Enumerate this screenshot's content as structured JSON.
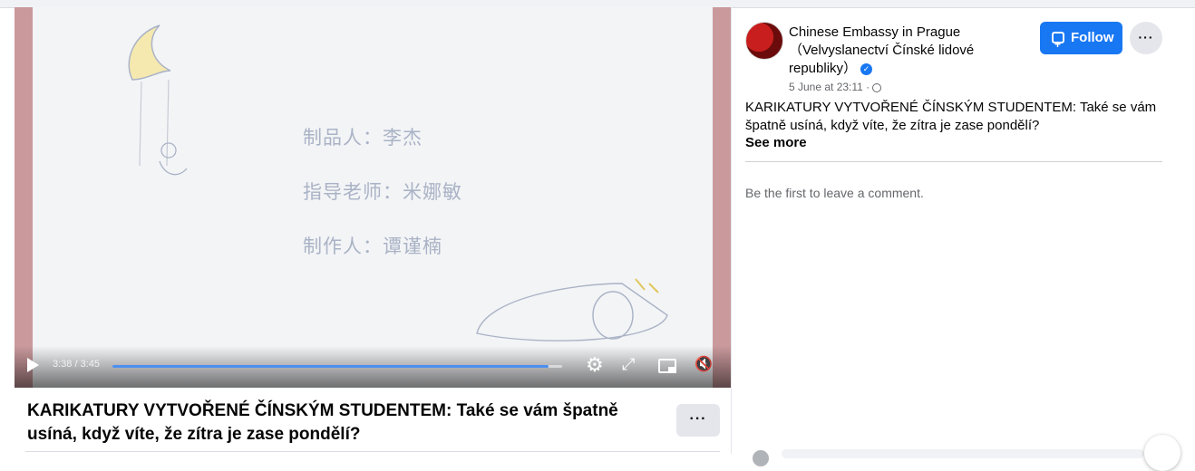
{
  "video": {
    "credits": [
      "制品人：李杰",
      "指导老师：米娜敏",
      "制作人：谭谨楠"
    ],
    "time": "3:38 / 3:45",
    "progress": 0.97
  },
  "video_title": "KARIKATURY VYTVOŘENÉ ČÍNSKÝM STUDENTEM: Také se vám špatně usíná, když víte, že zítra je zase pondělí?",
  "more_label": "···",
  "post": {
    "page_name": "Chinese Embassy in Prague （Velvyslanectví Čínské lidové republiky）",
    "verified_mark": "✓",
    "follow_label": "Follow",
    "more_label": "···",
    "date": "5 June at 23:11 ·",
    "text": "KARIKATURY VYTVOŘENÉ ČÍNSKÝM STUDENTEM: Také se vám špatně usíná, když víte, že zítra je zase pondělí?",
    "see_more": "See more"
  },
  "comments": {
    "empty_text": "Be the first to leave a comment."
  },
  "colors": {
    "accent": "#1877f2",
    "progress": "#4d8ff0"
  },
  "icons": [
    "play-icon",
    "settings-gear-icon",
    "fullscreen-icon",
    "pip-icon",
    "mute-icon",
    "verified-icon",
    "globe-icon",
    "follow-icon"
  ]
}
